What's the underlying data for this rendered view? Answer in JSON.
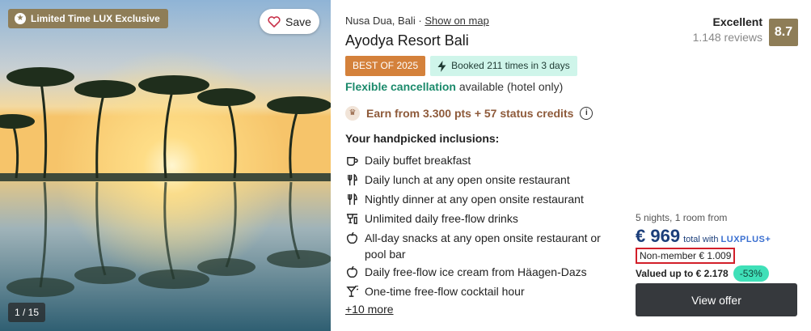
{
  "photo": {
    "badge": "Limited Time LUX Exclusive",
    "save_label": "Save",
    "counter": "1 / 15"
  },
  "listing": {
    "location": "Nusa Dua, Bali",
    "separator": "·",
    "map_link": "Show on map",
    "title": "Ayodya Resort Bali",
    "tag_best": "BEST OF 2025",
    "tag_booked": "Booked 211 times in 3 days",
    "flexible": "Flexible cancellation",
    "flexible_note": "available (hotel only)",
    "earn": "Earn from 3.300 pts + 57 status credits",
    "inclusions_heading": "Your handpicked inclusions:",
    "inclusions": [
      {
        "icon": "coffee-cup-icon",
        "text": "Daily buffet breakfast"
      },
      {
        "icon": "fork-knife-icon",
        "text": "Daily lunch at any open onsite restaurant"
      },
      {
        "icon": "fork-knife-icon",
        "text": "Nightly dinner at any open onsite restaurant"
      },
      {
        "icon": "drinks-icon",
        "text": "Unlimited daily free-flow drinks"
      },
      {
        "icon": "apple-icon",
        "text": "All-day snacks at any open onsite restaurant or pool bar"
      },
      {
        "icon": "apple-icon",
        "text": "Daily free-flow ice cream from Häagen-Dazs"
      },
      {
        "icon": "cocktail-icon",
        "text": "One-time free-flow cocktail hour"
      }
    ],
    "more_link": "+10 more"
  },
  "rating": {
    "label": "Excellent",
    "reviews": "1.148 reviews",
    "score": "8.7"
  },
  "price": {
    "nights": "5 nights, 1 room from",
    "amount": "€ 969",
    "total_with": "total with",
    "luxplus": "LUXPLUS+",
    "non_member": "Non-member € 1.009",
    "valued": "Valued up to € 2.178",
    "discount": "-53%",
    "cta": "View offer"
  },
  "colors": {
    "gold": "#8e7d57",
    "best_tag": "#d4813b",
    "booked_tag": "#cff5ea",
    "flexible_green": "#1b8a6b",
    "price_blue": "#1b3e7a",
    "highlight_red": "#d21f2a",
    "discount_green": "#3fe0b8",
    "cta_dark": "#36393d"
  }
}
